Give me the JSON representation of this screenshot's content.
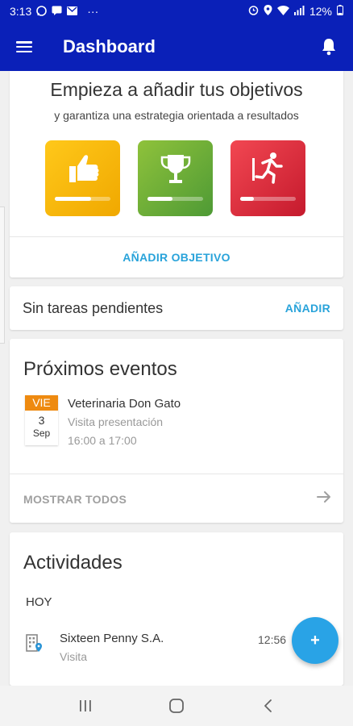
{
  "status_bar": {
    "time": "3:13",
    "battery": "12%",
    "notification_icons": [
      "whatsapp-icon",
      "message-icon",
      "gmail-icon"
    ],
    "overflow": "···",
    "system_icons": [
      "alarm-icon",
      "location-icon",
      "wifi-icon",
      "signal-icon",
      "battery-icon"
    ]
  },
  "app_bar": {
    "title": "Dashboard",
    "menu_icon": "menu-icon",
    "bell_icon": "bell-icon",
    "color": "#0a20b8"
  },
  "goals": {
    "title": "Empieza a añadir tus objetivos",
    "subtitle": "y garantiza una estrategia orientada a resultados",
    "tiles": [
      {
        "icon": "thumbs-up-icon",
        "color": "#f7b800",
        "progress": 0.65
      },
      {
        "icon": "trophy-icon",
        "color": "#6aab38",
        "progress": 0.45
      },
      {
        "icon": "running-person-icon",
        "color": "#e2303e",
        "progress": 0.25
      }
    ],
    "add_label": "AÑADIR OBJETIVO"
  },
  "tasks": {
    "label": "Sin tareas pendientes",
    "add_label": "AÑADIR"
  },
  "events": {
    "title": "Próximos eventos",
    "items": [
      {
        "day_of_week": "VIE",
        "day": "3",
        "month": "Sep",
        "name": "Veterinaria Don Gato",
        "type": "Visita presentación",
        "time": "16:00 a 17:00"
      }
    ],
    "show_all_label": "MOSTRAR TODOS",
    "accent": "#ee8a10"
  },
  "activities": {
    "title": "Actividades",
    "day_label": "HOY",
    "items": [
      {
        "icon": "building-location-icon",
        "name": "Sixteen Penny S.A.",
        "type": "Visita",
        "time": "12:56"
      }
    ]
  },
  "fab": {
    "label": "+",
    "color": "#29a3e6"
  },
  "nav_bar": {
    "buttons": [
      "recents-icon",
      "home-icon",
      "back-icon"
    ]
  }
}
